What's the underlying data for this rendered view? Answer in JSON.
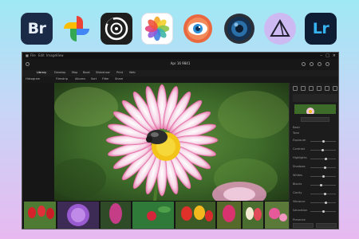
{
  "apps": [
    {
      "name": "Adobe Bridge",
      "label": "Br",
      "icon": "adobe-bridge-icon",
      "color": "#1b2b47",
      "text_color": "#e8eef8"
    },
    {
      "name": "Google Photos",
      "icon": "google-photos-icon",
      "colors": [
        "#ea4335",
        "#fbbc04",
        "#34a853",
        "#4285f4"
      ]
    },
    {
      "name": "Camera app",
      "icon": "camera-lens-icon",
      "color": "#1e1e1e"
    },
    {
      "name": "Apple Photos",
      "icon": "apple-photos-icon"
    },
    {
      "name": "XnView",
      "icon": "xnview-eye-icon",
      "color": "#e9683f"
    },
    {
      "name": "Aperture",
      "icon": "aperture-lens-icon",
      "color": "#1e2c3c"
    },
    {
      "name": "Affinity Photo",
      "icon": "affinity-triangle-icon",
      "color": "#cdbaf2"
    },
    {
      "name": "Adobe Lightroom",
      "label": "Lr",
      "icon": "adobe-lightroom-icon",
      "color": "#0f1d34",
      "text_color": "#36b3f1"
    }
  ],
  "window": {
    "title": "Apr 16 9841",
    "doc_title": "Apr 16 9841",
    "left_menu": [
      "File",
      "Edit",
      "Image",
      "View"
    ],
    "tabs": [
      "Library",
      "Develop",
      "Map",
      "Book",
      "Slideshow",
      "Print",
      "Web"
    ],
    "subtabs": [
      "Histogram",
      "Filmstrip",
      "Albums",
      "Sort",
      "Filter",
      "Share"
    ],
    "panel": {
      "sections": [
        "Basic",
        "Tone",
        "Presence"
      ],
      "sliders": [
        "Exposure",
        "Contrast",
        "Highlights",
        "Shadows",
        "Whites",
        "Blacks",
        "Clarity",
        "Vibrance",
        "Saturation"
      ],
      "slider_levels": [
        0.5,
        0.45,
        0.6,
        0.55,
        0.5,
        0.4,
        0.55,
        0.6,
        0.5
      ],
      "buttons": [
        "Auto",
        "Reset"
      ]
    }
  },
  "photo": {
    "subject": "pink daisy flower with bee"
  },
  "filmstrip": {
    "thumbnails": [
      "red tulips",
      "purple allium",
      "pink hyacinth",
      "red flower green leaves",
      "red and yellow tulips",
      "pink tulips",
      "white and red tulips",
      "pink flowers"
    ]
  },
  "colors": {
    "background_top": "#9fe8f4",
    "background_bottom": "#e7b9f0",
    "window_bg": "#1b1b1b"
  }
}
